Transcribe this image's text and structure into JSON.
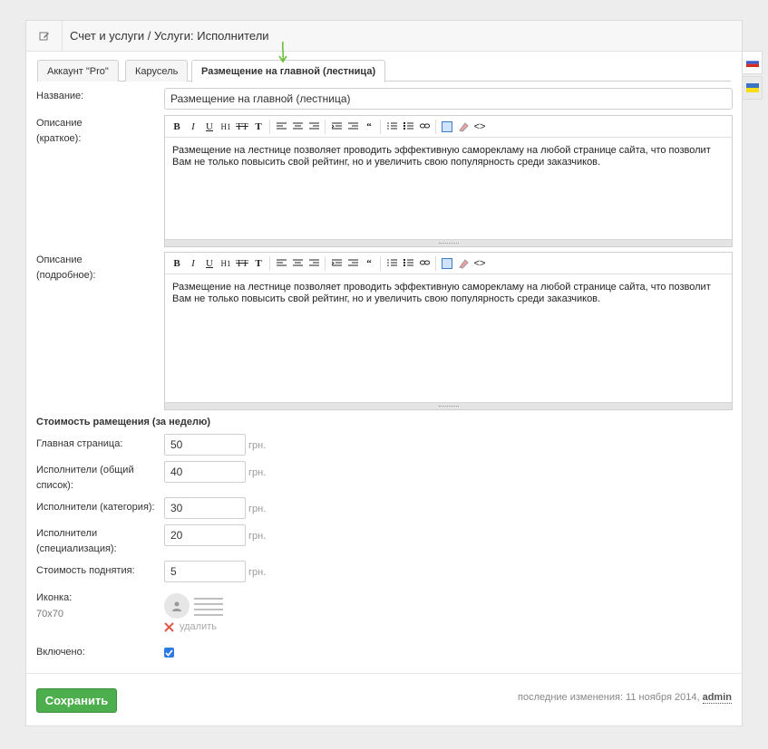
{
  "header": {
    "title": "Счет и услуги / Услуги: Исполнители",
    "edit_icon": "edit-icon"
  },
  "tabs": [
    {
      "label": "Аккаунт \"Pro\""
    },
    {
      "label": "Карусель"
    },
    {
      "label": "Размещение на главной (лестница)",
      "active": true
    }
  ],
  "form": {
    "name_label": "Название:",
    "name_value": "Размещение на главной (лестница)",
    "short_desc_label_1": "Описание",
    "short_desc_label_2": "(краткое):",
    "short_desc_text": "Размещение на лестнице позволяет проводить эффективную саморекламу на любой странице сайта, что позволит Вам не только повысить свой рейтинг, но и увеличить свою популярность среди заказчиков.",
    "long_desc_label_1": "Описание",
    "long_desc_label_2": "(подробное):",
    "long_desc_text": "Размещение на лестнице позволяет проводить эффективную саморекламу на любой странице сайта, что позволит Вам не только повысить свой рейтинг, но и увеличить свою популярность среди заказчиков.",
    "toolbar": [
      "B",
      "I",
      "U",
      "H1",
      "TT",
      "T",
      "align-left",
      "align-center",
      "align-right",
      "outdent",
      "indent",
      "quote",
      "ordered-list",
      "unordered-list",
      "link",
      "fullscreen",
      "eraser",
      "code"
    ],
    "toolbar_glyphs": {
      "quote": "“",
      "code": "<>"
    },
    "price_section_title": "Стоимость рамещения (за неделю)",
    "prices": [
      {
        "label_1": "Главная страница:",
        "label_2": "",
        "value": "50",
        "unit": "грн."
      },
      {
        "label_1": "Исполнители (общий",
        "label_2": "список):",
        "value": "40",
        "unit": "грн."
      },
      {
        "label_1": "Исполнители (категория):",
        "label_2": "",
        "value": "30",
        "unit": "грн."
      },
      {
        "label_1": "Исполнители",
        "label_2": "(специализация):",
        "value": "20",
        "unit": "грн."
      },
      {
        "label_1": "Стоимость поднятия:",
        "label_2": "",
        "value": "5",
        "unit": "грн."
      }
    ],
    "icon_label": "Иконка:",
    "icon_size": "70x70",
    "delete_label": "удалить",
    "enabled_label": "Включено:",
    "enabled": true
  },
  "footer": {
    "save_label": "Сохранить",
    "last_change_text": "последние изменения: 11 ноября 2014,",
    "last_change_user": "admin"
  },
  "colors": {
    "save_button": "#4cae4c",
    "checkbox": "#2d7be5",
    "arrow": "#6bbf3a"
  }
}
